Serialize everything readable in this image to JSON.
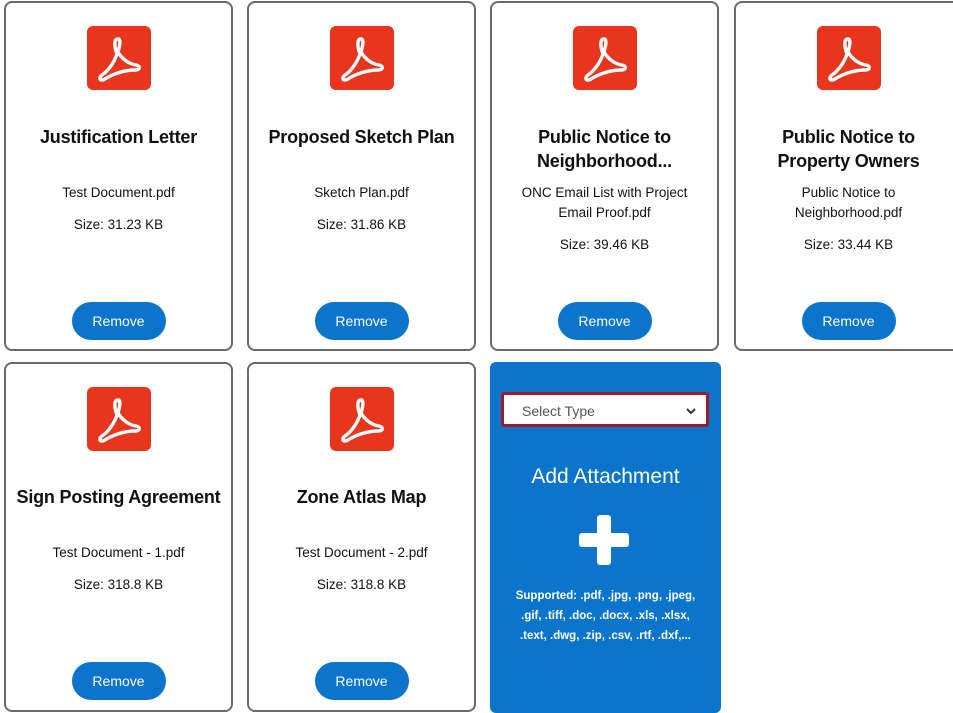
{
  "cards": [
    {
      "title": "Justification Letter",
      "filename": "Test Document.pdf",
      "size": "Size: 31.23 KB",
      "remove_label": "Remove",
      "icon": "pdf-icon"
    },
    {
      "title": "Proposed Sketch Plan",
      "filename": "Sketch Plan.pdf",
      "size": "Size: 31.86 KB",
      "remove_label": "Remove",
      "icon": "pdf-icon"
    },
    {
      "title_line1": "Public Notice to",
      "title_line2": "Neighborhood...",
      "filename_line1": "ONC Email List with Project",
      "filename_line2": "Email Proof.pdf",
      "size": "Size: 39.46 KB",
      "remove_label": "Remove",
      "icon": "pdf-icon"
    },
    {
      "title_line1": "Public Notice to",
      "title_line2": "Property Owners",
      "filename_line1": "Public Notice to",
      "filename_line2": "Neighborhood.pdf",
      "size": "Size: 33.44 KB",
      "remove_label": "Remove",
      "icon": "pdf-icon"
    },
    {
      "title": "Sign Posting Agreement",
      "filename": "Test Document - 1.pdf",
      "size": "Size: 318.8 KB",
      "remove_label": "Remove",
      "icon": "pdf-icon"
    },
    {
      "title": "Zone Atlas Map",
      "filename": "Test Document - 2.pdf",
      "size": "Size: 318.8 KB",
      "remove_label": "Remove",
      "icon": "pdf-icon"
    }
  ],
  "add_attachment": {
    "select_value": "Select Type",
    "title": "Add Attachment",
    "icon": "plus-icon",
    "supported_line1": "Supported: .pdf, .jpg, .png, .jpeg,",
    "supported_line2": ".gif, .tiff, .doc, .docx, .xls, .xlsx,",
    "supported_line3": ".text, .dwg, .zip, .csv, .rtf, .dxf,..."
  },
  "colors": {
    "accent_blue": "#0b74cb",
    "pdf_red": "#e8351e",
    "select_border": "#a3172b",
    "card_border": "#6a6a6a"
  }
}
